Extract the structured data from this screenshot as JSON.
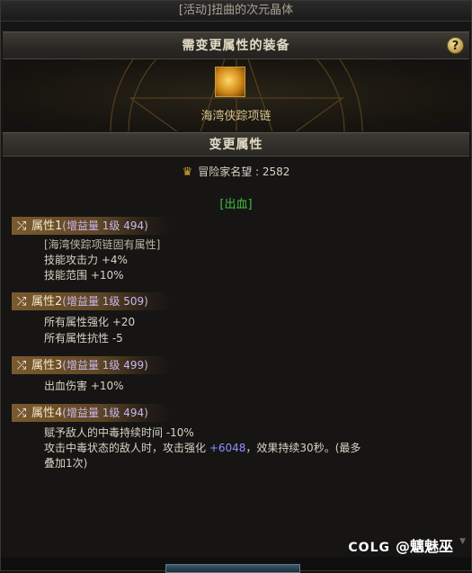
{
  "window": {
    "title": "[活动]扭曲的次元晶体"
  },
  "section1": {
    "title": "需变更属性的装备",
    "help": "?"
  },
  "equipment": {
    "name": "海湾侠踪项链",
    "icon": "golden-necklace-icon"
  },
  "section2": {
    "title": "变更属性"
  },
  "reputation": {
    "icon": "crest-icon",
    "label": "冒险家名望 : 2582"
  },
  "tag": "[出血]",
  "attributes": [
    {
      "name": "属性1",
      "extra": "(增益量 1级 494)",
      "lines": [
        "[海湾侠踪项链固有属性]",
        "技能攻击力 +4%",
        "技能范围 +10%"
      ]
    },
    {
      "name": "属性2",
      "extra": "(增益量 1级 509)",
      "lines": [
        "所有属性强化 +20",
        "所有属性抗性 -5"
      ]
    },
    {
      "name": "属性3",
      "extra": "(增益量 1级 499)",
      "lines": [
        "出血伤害 +10%"
      ]
    },
    {
      "name": "属性4",
      "extra": "(增益量 1级 494)",
      "lines": [
        "赋予敌人的中毒持续时间 -10%"
      ],
      "line2_pre": "攻击中毒状态的敌人时，攻击强化 ",
      "line2_value": "+6048",
      "line2_post": "，效果持续30秒。(最多",
      "line3": "叠加1次)"
    }
  ],
  "watermark": {
    "logo": "COLG",
    "handle": "@魑魅巫"
  },
  "colors": {
    "accent_gold": "#d9a433",
    "tag_green": "#3fbf3f",
    "value_blue": "#8f8fff"
  }
}
